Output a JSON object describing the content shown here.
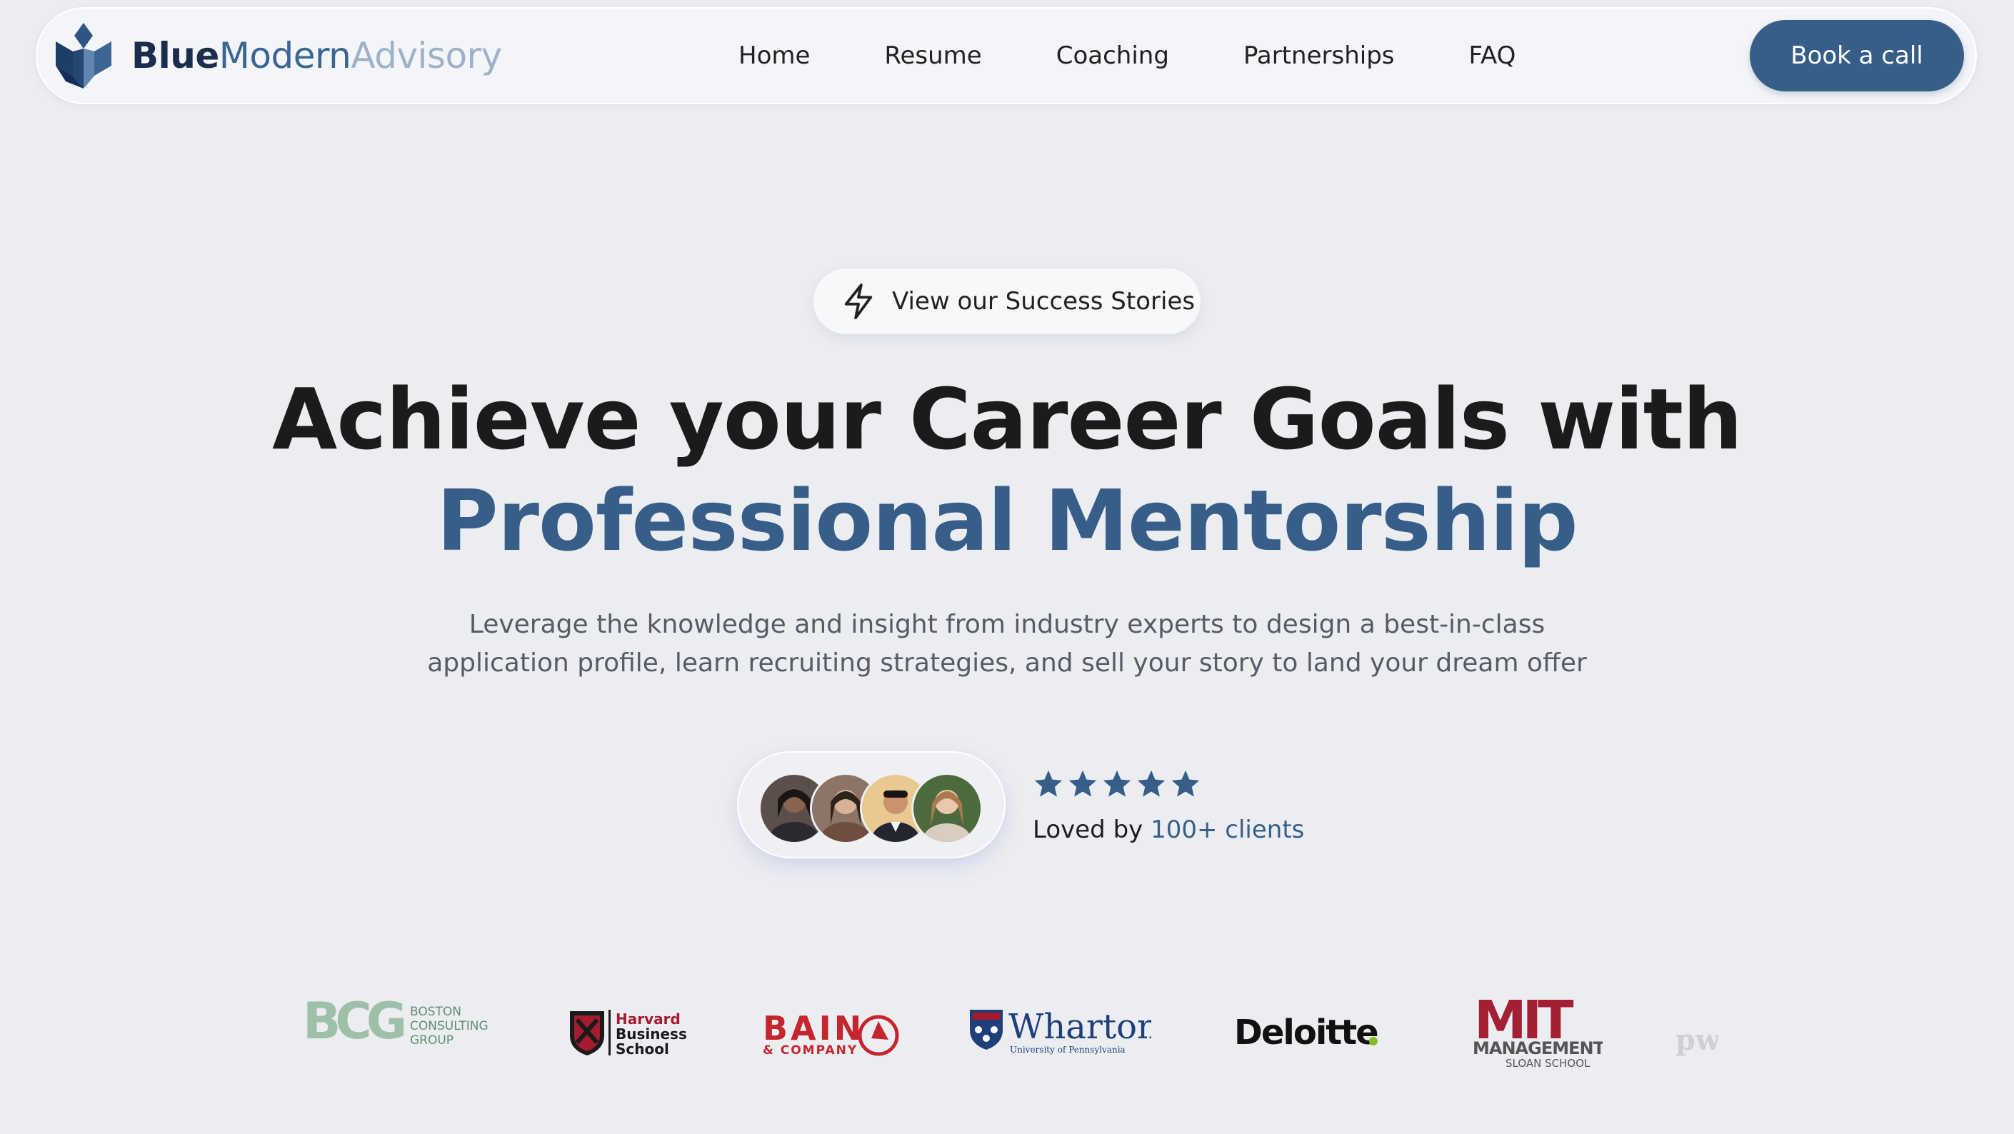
{
  "brand": {
    "part1": "Blue",
    "part2": "Modern",
    "part3": "Advisory"
  },
  "nav": {
    "home": "Home",
    "resume": "Resume",
    "coaching": "Coaching",
    "partnerships": "Partnerships",
    "faq": "FAQ"
  },
  "cta": {
    "book": "Book a call"
  },
  "success_pill": {
    "label": "View our Success Stories"
  },
  "hero": {
    "line1": "Achieve your Career Goals with",
    "line2": "Professional Mentorship",
    "subtitle": "Leverage the knowledge and insight from industry experts to design a best-in-class application profile, learn recruiting strategies, and sell your story to land your dream offer"
  },
  "rating": {
    "stars": 5,
    "prefix": "Loved by",
    "count": "100+ clients"
  },
  "logos": {
    "bcg_letters": "BCG",
    "bcg_line1": "BOSTON",
    "bcg_line2": "CONSULTING",
    "bcg_line3": "GROUP",
    "hbs_line1": "Harvard",
    "hbs_line2": "Business",
    "hbs_line3": "School",
    "bain_main": "BAIN",
    "bain_sub": "& COMPANY",
    "wharton_main": "Wharton",
    "wharton_sub": "University of Pennsylvania",
    "deloitte": "Deloitte",
    "mit_main": "MIT",
    "mit_line2": "MANAGEMENT",
    "mit_line3": "SLOAN SCHOOL",
    "pwc": "pw"
  },
  "colors": {
    "accent": "#365E88",
    "background": "#ECEDF1",
    "bain_red": "#C4262E",
    "deloitte_green": "#86BC25",
    "mit_red": "#A31F34"
  }
}
